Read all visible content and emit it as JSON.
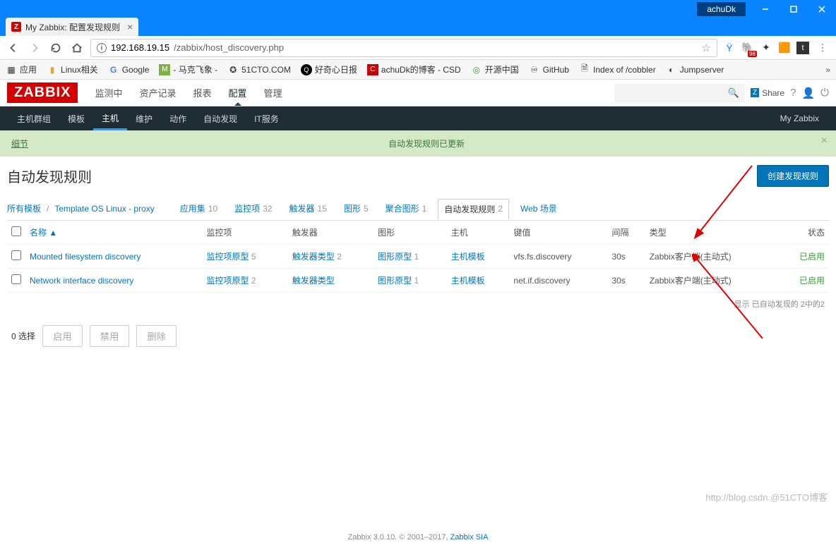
{
  "window": {
    "user": "achuDk"
  },
  "tab": {
    "title": "My Zabbix: 配置发现规则"
  },
  "url": {
    "host": "192.168.19.15",
    "path": "/zabbix/host_discovery.php"
  },
  "bookmarks": {
    "apps": "应用",
    "items": [
      "Linux相关",
      "Google",
      "- 马克飞象 -",
      "51CTO.COM",
      "好奇心日报",
      "achuDk的博客 - CSD",
      "开源中国",
      "GitHub",
      "Index of /cobbler",
      "Jumpserver"
    ]
  },
  "nav": {
    "logo": "ZABBIX",
    "main": [
      "监测中",
      "资产记录",
      "报表",
      "配置",
      "管理"
    ],
    "active_main": 3,
    "share": "Share",
    "sub": [
      "主机群组",
      "模板",
      "主机",
      "维护",
      "动作",
      "自动发现",
      "IT服务"
    ],
    "active_sub": 2,
    "right_label": "My Zabbix"
  },
  "alert": {
    "detail": "细节",
    "message": "自动发现规则已更新"
  },
  "page": {
    "title": "自动发现规则",
    "create_btn": "创建发现规则",
    "breadcrumb": {
      "all_templates": "所有模板",
      "template_name": "Template OS Linux - proxy"
    },
    "tabs": [
      {
        "label": "应用集",
        "count": "10"
      },
      {
        "label": "监控项",
        "count": "32"
      },
      {
        "label": "触发器",
        "count": "15"
      },
      {
        "label": "图形",
        "count": "5"
      },
      {
        "label": "聚合图形",
        "count": "1"
      },
      {
        "label": "自动发现规则",
        "count": "2",
        "active": true
      },
      {
        "label": "Web 场景",
        "count": ""
      }
    ]
  },
  "table": {
    "headers": {
      "name": "名称 ▲",
      "items": "监控项",
      "triggers": "触发器",
      "graphs": "图形",
      "hosts": "主机",
      "key": "键值",
      "interval": "间隔",
      "type": "类型",
      "status": "状态"
    },
    "rows": [
      {
        "name": "Mounted filesystem discovery",
        "items_label": "监控项原型",
        "items_cnt": "5",
        "trig_label": "触发器类型",
        "trig_cnt": "2",
        "graph_label": "图形原型",
        "graph_cnt": "1",
        "host": "主机模板",
        "key": "vfs.fs.discovery",
        "interval": "30s",
        "type": "Zabbix客户端(主动式)",
        "status": "已启用"
      },
      {
        "name": "Network interface discovery",
        "items_label": "监控项原型",
        "items_cnt": "2",
        "trig_label": "触发器类型",
        "trig_cnt": "",
        "graph_label": "图形原型",
        "graph_cnt": "1",
        "host": "主机模板",
        "key": "net.if.discovery",
        "interval": "30s",
        "type": "Zabbix客户端(主动式)",
        "status": "已启用"
      }
    ],
    "summary": "显示 已自动发现的 2中的2"
  },
  "actions": {
    "selected": "0 选择",
    "enable": "启用",
    "disable": "禁用",
    "delete": "删除"
  },
  "footer": {
    "text": "Zabbix 3.0.10. © 2001–2017, ",
    "link": "Zabbix SIA"
  },
  "watermark": "http://blog.csdn.@51CTO博客"
}
